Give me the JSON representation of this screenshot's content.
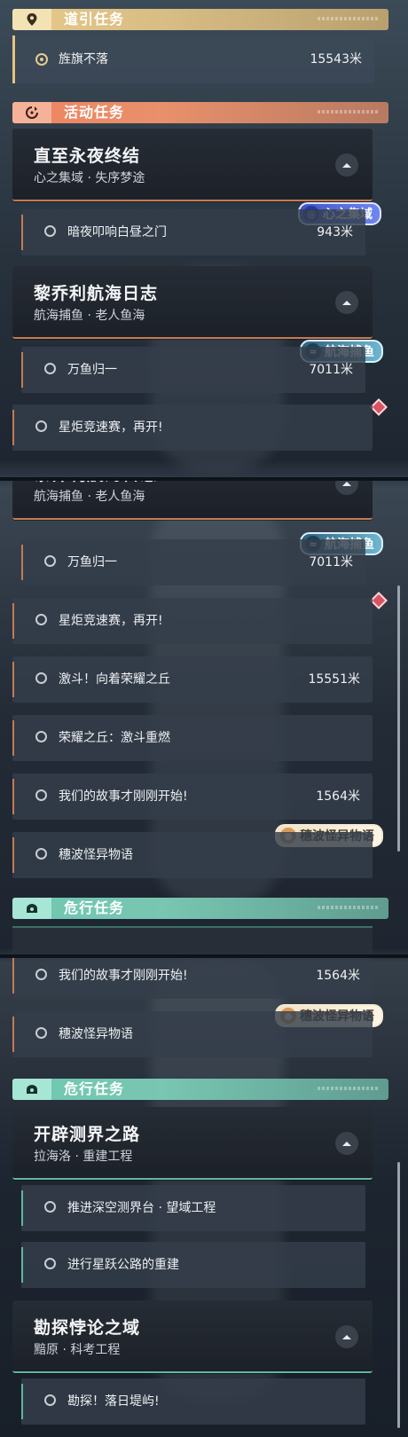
{
  "sections": {
    "guide": "道引任务",
    "activity": "活动任务",
    "danger": "危行任务"
  },
  "guide_quest": {
    "title": "旌旗不落",
    "distance": "15543米"
  },
  "quest_groups": {
    "eternal_night": {
      "title": "直至永夜终结",
      "subtitle": "心之集域 · 失序梦途",
      "tag": "心之集域"
    },
    "fishing_log": {
      "title": "黎乔利航海日志",
      "subtitle": "航海捕鱼 · 老人鱼海",
      "tag": "航海捕鱼"
    },
    "survey_road": {
      "title": "开辟测界之路",
      "subtitle": "拉海洛 · 重建工程"
    },
    "paradox_domain": {
      "title": "勘探悖论之域",
      "subtitle": "黯原 · 科考工程"
    }
  },
  "quests": {
    "dark_night_door": {
      "title": "暗夜叩响白昼之门",
      "distance": "943米"
    },
    "wanyu": {
      "title": "万鱼归一",
      "distance": "7011米"
    },
    "torch_race": {
      "title": "星炬竞速赛，再开!"
    },
    "glory_hill": {
      "title": "激斗！向着荣耀之丘",
      "distance": "15551米"
    },
    "glory_reignite": {
      "title": "荣耀之丘：激斗重燃"
    },
    "story_begin": {
      "title": "我们的故事才刚刚开始!",
      "distance": "1564米"
    },
    "suibo_tale": {
      "title": "穗波怪异物语",
      "tag": "穗波怪异物语"
    },
    "deep_space": {
      "title": "推进深空测界台 · 望域工程"
    },
    "star_road": {
      "title": "进行星跃公路的重建"
    },
    "sunset_isle": {
      "title": "勘探！落日堤屿!"
    }
  },
  "icons": {
    "guide_badge": "map-pin-icon",
    "activity_badge": "activity-refresh-icon",
    "danger_badge": "danger-helm-icon",
    "collapse": "chevron-up-icon",
    "quest_status": "circle-icon",
    "alert": "red-diamond-icon"
  },
  "colors": {
    "guide_accent": "#e5c27d",
    "activity_accent": "#ef8461",
    "danger_accent": "#6fc8b0"
  }
}
